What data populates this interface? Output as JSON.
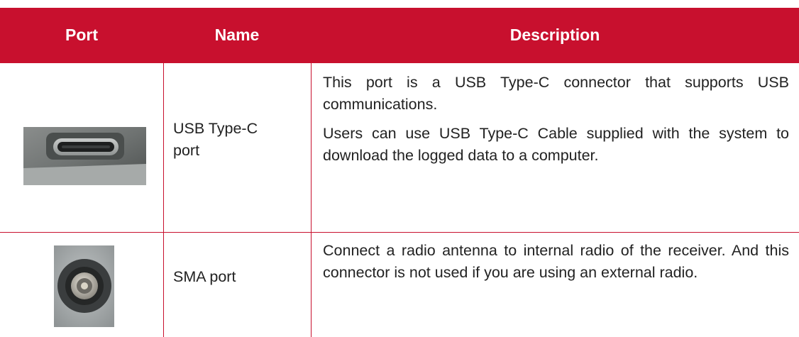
{
  "table": {
    "headers": {
      "port": "Port",
      "name": "Name",
      "description": "Description"
    },
    "rows": [
      {
        "image": "usb-type-c-port-photo",
        "name": "USB  Type-C port",
        "name_line1": "USB  Type-C",
        "name_line2": "port",
        "description": [
          "This port is a USB  Type-C connector that supports USB communications.",
          "Users can use USB  Type-C Cable supplied with the system to download the logged data to a computer."
        ]
      },
      {
        "image": "sma-port-photo",
        "name": "SMA port",
        "description": [
          "Connect a radio antenna to internal radio of the receiver. And this connector is not used if you are using an external radio."
        ]
      }
    ]
  },
  "colors": {
    "accent": "#c8102e",
    "header_text": "#ffffff"
  }
}
